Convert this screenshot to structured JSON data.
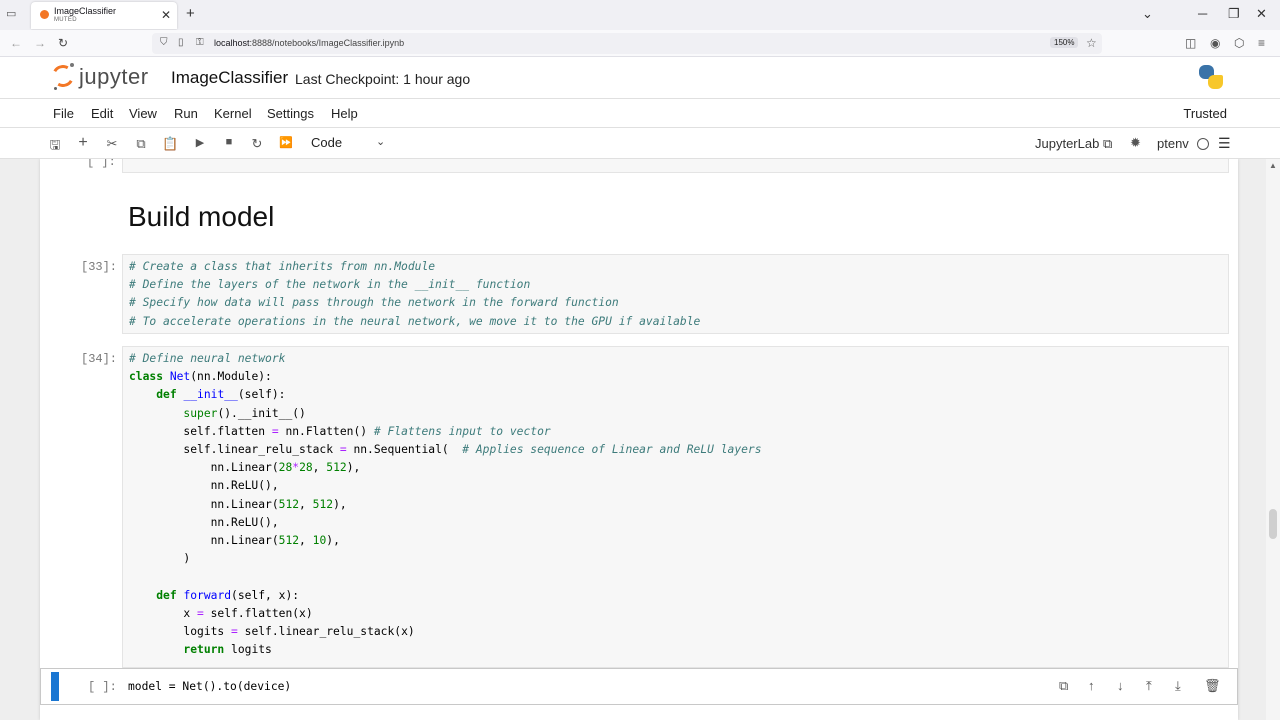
{
  "browser": {
    "tab_title": "ImageClassifier",
    "tab_subtitle": "MUTED",
    "url_host": "localhost",
    "url_rest": ":8888/notebooks/ImageClassifier.ipynb",
    "zoom": "150%"
  },
  "header": {
    "logo_text": "jupyter",
    "notebook_name": "ImageClassifier",
    "checkpoint": "Last Checkpoint: 1 hour ago"
  },
  "menubar": {
    "items": [
      "File",
      "Edit",
      "View",
      "Run",
      "Kernel",
      "Settings",
      "Help"
    ],
    "trusted": "Trusted"
  },
  "toolbar": {
    "cell_type": "Code",
    "jupyterlab_label": "JupyterLab",
    "kernel_name": "ptenv"
  },
  "notebook": {
    "heading": "Build model",
    "cells": [
      {
        "prompt": "[33]:"
      },
      {
        "prompt": "[34]:"
      },
      {
        "prompt": "[ ]:",
        "code": "model = Net().to(device)"
      }
    ]
  },
  "icons": {
    "save": "save-icon",
    "add": "plus-icon",
    "cut": "scissors-icon",
    "copy": "copy-icon",
    "paste": "paste-icon",
    "run": "play-icon",
    "stop": "stop-icon",
    "restart": "refresh-icon",
    "run_all": "fast-forward-icon"
  }
}
